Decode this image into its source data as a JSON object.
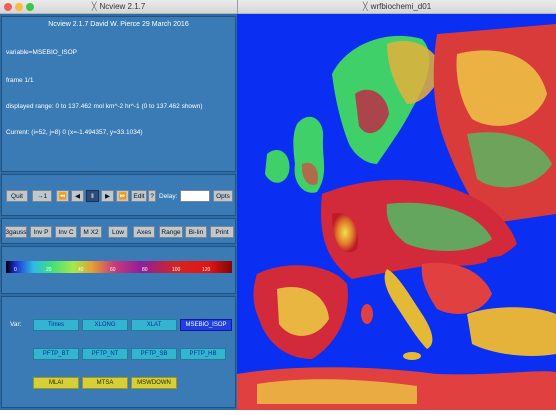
{
  "windows": {
    "left_title": "Ncview 2.1.7",
    "right_title": "wrfbiochemi_d01"
  },
  "info": {
    "header": "Ncview 2.1.7 David W. Pierce  29 March 2016",
    "variable": "variable=MSEBIO_ISOP",
    "frame": "frame 1/1",
    "range": "displayed range: 0 to 137.462 mol km^-2 hr^-1 (0 to 137.462 shown)",
    "current": "Current: (i=52, j=8) 0 (x=-1.494357, y=33.1034)"
  },
  "controls": {
    "quit": "Quit",
    "minus1": "→1",
    "rewind": "⏪",
    "back": "◀",
    "pause": "‖",
    "forward": "▶",
    "ffwd": "⏩",
    "edit": "Edit",
    "help": "?",
    "delay_label": "Delay:",
    "opts": "Opts"
  },
  "tools": [
    "3gauss",
    "Inv P",
    "Inv C",
    "M X2",
    "Low",
    "Axes",
    "Range",
    "Bi-lin",
    "Print"
  ],
  "colorbar": {
    "ticks": [
      "0",
      "20",
      "40",
      "60",
      "80",
      "100",
      "120"
    ]
  },
  "vars": {
    "label": "Var:",
    "row1": [
      "Times",
      "XLONG",
      "XLAT",
      "MSEBIO_ISOP"
    ],
    "row2": [
      "PFTP_BT",
      "PFTP_NT",
      "PFTP_SB",
      "PFTP_HB"
    ],
    "row3": [
      "MLAI",
      "MTSA",
      "MSWDOWN"
    ]
  },
  "colors": {
    "panel": "#2d6ca6",
    "ocean": "#0a2ef2",
    "selected_var": "#1f3fe4"
  }
}
